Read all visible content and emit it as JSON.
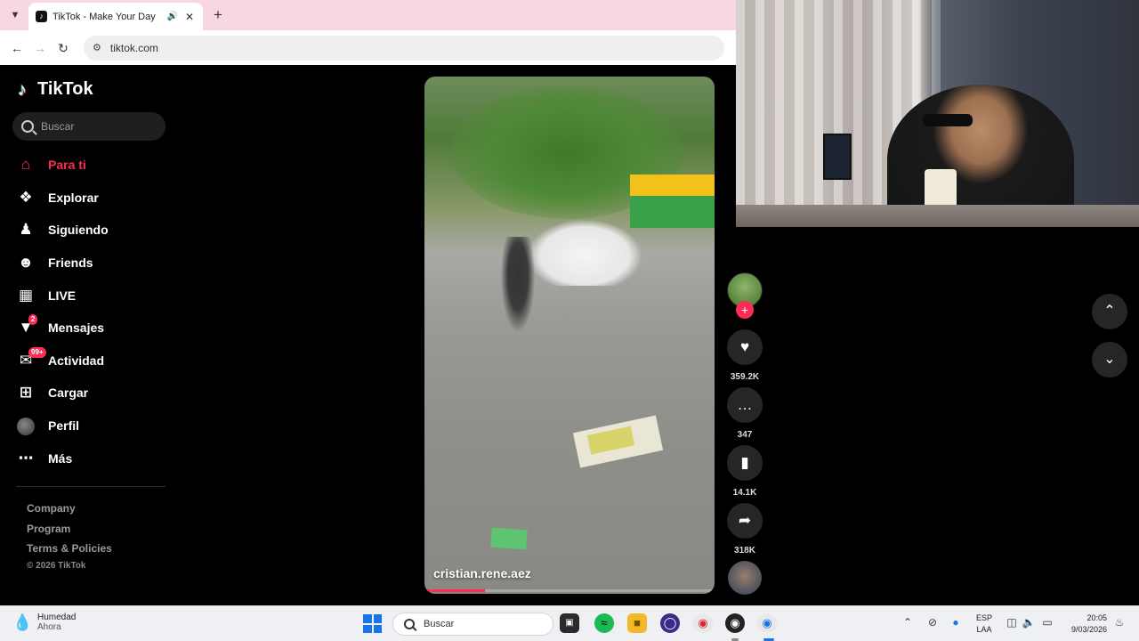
{
  "browser": {
    "tab_title": "TikTok - Make Your Day",
    "url": "tiktok.com"
  },
  "tiktok": {
    "logo_text": "TikTok",
    "search_placeholder": "Buscar",
    "nav": [
      {
        "label": "Para ti",
        "icon": "home-icon",
        "active": true
      },
      {
        "label": "Explorar",
        "icon": "compass-icon"
      },
      {
        "label": "Siguiendo",
        "icon": "following-icon"
      },
      {
        "label": "Friends",
        "icon": "friends-icon"
      },
      {
        "label": "LIVE",
        "icon": "live-icon"
      },
      {
        "label": "Mensajes",
        "icon": "messages-icon",
        "badge": "2"
      },
      {
        "label": "Actividad",
        "icon": "activity-icon",
        "badge": "99+"
      },
      {
        "label": "Cargar",
        "icon": "upload-icon"
      },
      {
        "label": "Perfil",
        "icon": "avatar"
      },
      {
        "label": "Más",
        "icon": "more-icon"
      }
    ],
    "footer": {
      "links": [
        "Company",
        "Program",
        "Terms & Policies"
      ],
      "copyright": "© 2026 TikTok"
    },
    "video": {
      "author": "cristian.rene.aez",
      "progress": 0.21
    },
    "actions": {
      "likes": "359.2K",
      "comments": "347",
      "saves": "14.1K",
      "shares": "318K"
    }
  },
  "taskbar": {
    "weather_title": "Humedad",
    "weather_sub": "Ahora",
    "search_label": "Buscar",
    "lang_line1": "ESP",
    "lang_line2": "LAA",
    "time": "20:05",
    "date": "9/03/2026"
  }
}
